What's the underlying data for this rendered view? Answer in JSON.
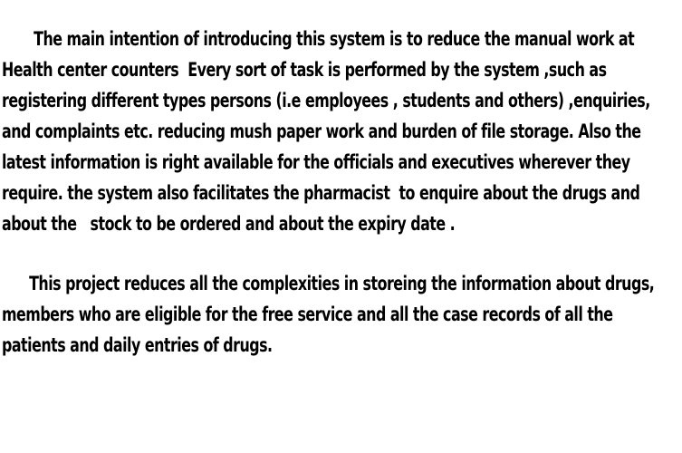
{
  "document": {
    "paragraphs": [
      {
        "lines": [
          "       The main intention of introducing this system is to reduce the manual work at",
          "Health center counters  Every sort of task is performed by the system ,such as",
          "registering different types persons (i.e employees , students and others) ,enquiries,",
          "and complaints etc. reducing mush paper work and burden of file storage. Also the",
          "latest information is right available for the officials and executives wherever they",
          "require. the system also facilitates the pharmacist  to enquire about the drugs and",
          "about the   stock to be ordered and about the expiry date ."
        ]
      },
      {
        "lines": [
          "      This project reduces all the complexities in storeing the information about drugs,",
          "members who are eligible for the free service and all the case records of all the",
          "patients and daily entries of drugs."
        ]
      }
    ]
  }
}
